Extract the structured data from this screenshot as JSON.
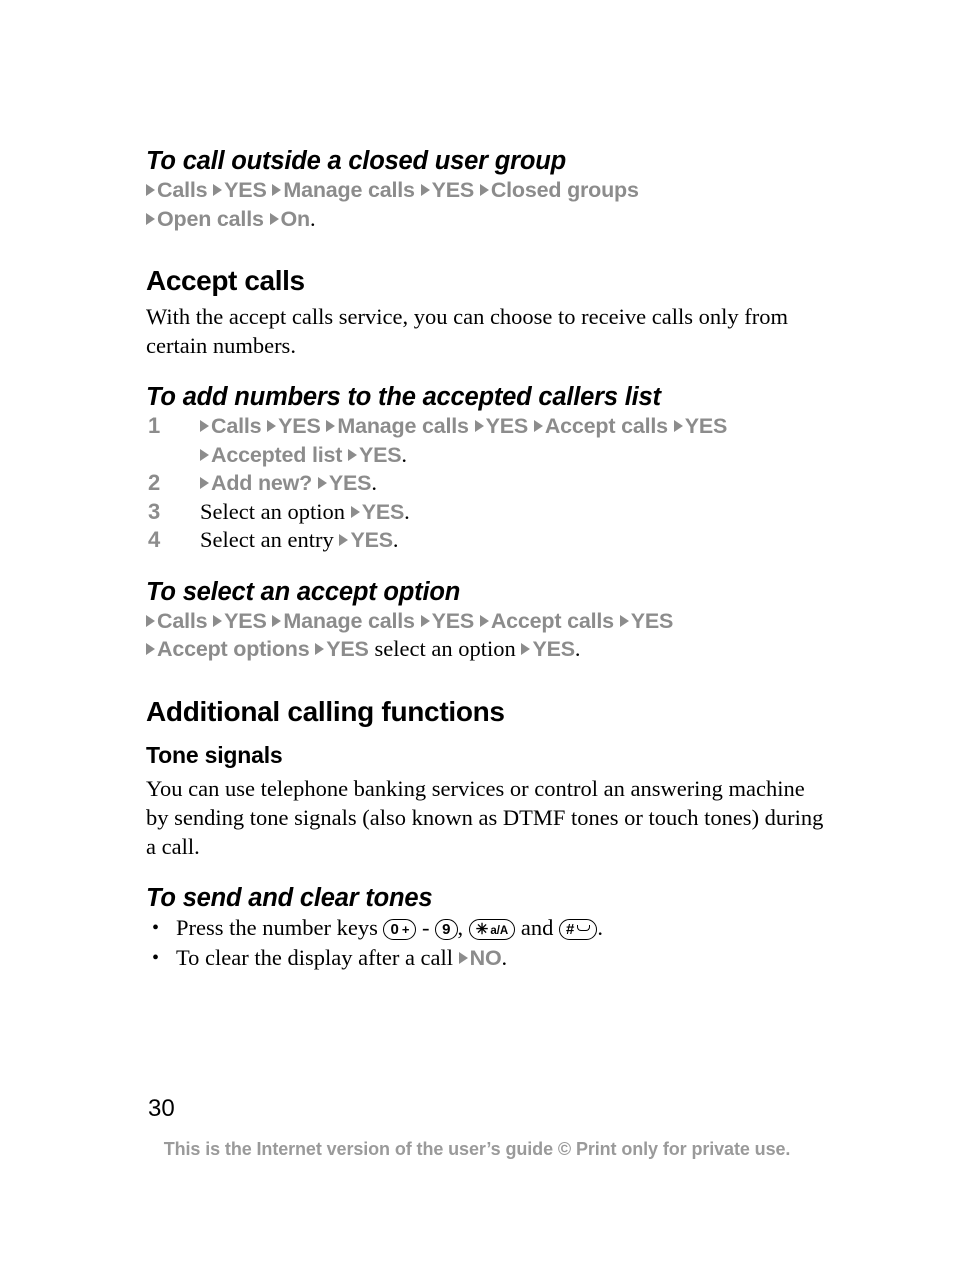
{
  "document": {
    "page_number": "30",
    "footer": "This is the Internet version of the user’s guide © Print only for private use.",
    "colors": {
      "path_gray": "#8c8c8c",
      "footer_gray": "#9a9a9a",
      "text_black": "#000000",
      "background": "#ffffff"
    }
  },
  "sections": {
    "closed_user_group": {
      "heading": "To call outside a closed user group",
      "path_line_1": [
        "Calls",
        "YES",
        "Manage calls",
        "YES",
        "Closed groups"
      ],
      "path_line_2": [
        "Open calls",
        "On"
      ],
      "terminator": "."
    },
    "accept_calls": {
      "heading": "Accept calls",
      "body": "With the accept calls service, you can choose to receive calls only from certain numbers."
    },
    "add_numbers": {
      "heading": "To add numbers to the accepted callers list",
      "steps": [
        {
          "number": "1",
          "line_1": [
            "Calls",
            "YES",
            "Manage calls",
            "YES",
            "Accept calls",
            "YES"
          ],
          "line_2": [
            "Accepted list",
            "YES"
          ],
          "terminator": "."
        },
        {
          "number": "2",
          "line_1": [
            "Add new?",
            "YES"
          ],
          "terminator": "."
        },
        {
          "number": "3",
          "serif_text": "Select an option",
          "line_1": [
            "YES"
          ],
          "terminator": "."
        },
        {
          "number": "4",
          "serif_text": "Select an entry",
          "line_1": [
            "YES"
          ],
          "terminator": "."
        }
      ]
    },
    "accept_option": {
      "heading": "To select an accept option",
      "path_line_1": [
        "Calls",
        "YES",
        "Manage calls",
        "YES",
        "Accept calls",
        "YES"
      ],
      "path_line_2_a": [
        "Accept options",
        "YES"
      ],
      "path_line_2_serif": "select an option",
      "path_line_2_b": [
        "YES"
      ],
      "terminator": "."
    },
    "additional_functions": {
      "heading": "Additional calling functions"
    },
    "tone_signals": {
      "heading": "Tone signals",
      "body": "You can use telephone banking services or control an answering machine by sending tone signals (also known as DTMF tones or touch tones) during a call."
    },
    "send_clear_tones": {
      "heading": "To send and clear tones",
      "bullet_1": {
        "lead": "Press the number keys",
        "key_zero": {
          "main": "0",
          "plus": "+"
        },
        "dash": "-",
        "key_nine": {
          "main": "9"
        },
        "comma": ",",
        "key_star": {
          "main": "✳",
          "sub": "a/A"
        },
        "and": "and",
        "key_hash": {
          "main": "#",
          "space_symbol": "space-key-icon"
        },
        "terminator": "."
      },
      "bullet_2": {
        "lead": "To clear the display after a call",
        "path": [
          "NO"
        ],
        "terminator": "."
      }
    }
  }
}
